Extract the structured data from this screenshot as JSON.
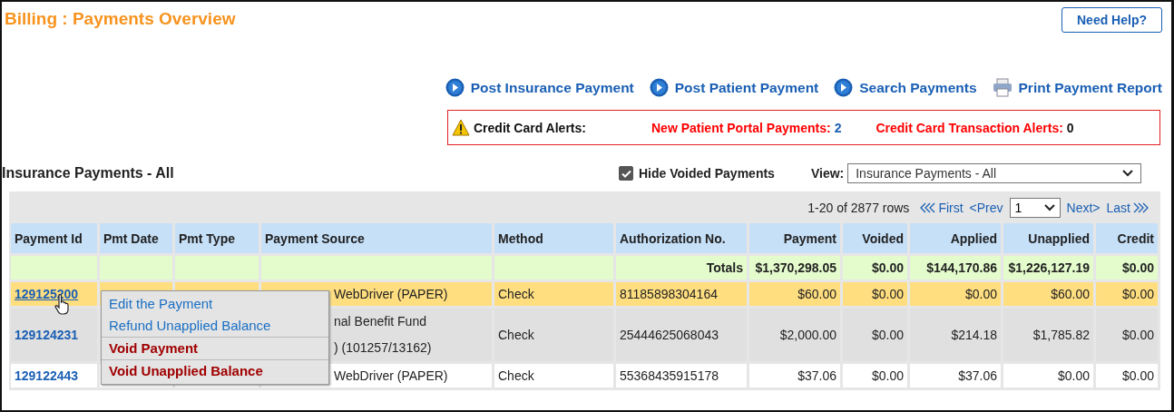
{
  "page_title": "Billing : Payments Overview",
  "help_button": "Need Help?",
  "actions": [
    {
      "kind": "play",
      "label": "Post Insurance Payment"
    },
    {
      "kind": "play",
      "label": "Post Patient Payment"
    },
    {
      "kind": "play",
      "label": "Search Payments"
    },
    {
      "kind": "print",
      "label": "Print Payment Report"
    }
  ],
  "alerts": {
    "title": "Credit Card Alerts:",
    "items": [
      {
        "label": "New Patient Portal Payments:",
        "count": "2",
        "linked": true
      },
      {
        "label": "Credit Card Transaction Alerts:",
        "count": "0",
        "linked": false
      }
    ]
  },
  "section_title": "Insurance Payments - All",
  "hide_voided": {
    "label": "Hide Voided Payments",
    "checked": true
  },
  "view": {
    "label": "View:",
    "value": "Insurance Payments - All"
  },
  "pager": {
    "summary": "1-20 of 2877 rows",
    "first": "First",
    "prev": "<Prev",
    "page": "1",
    "next": "Next>",
    "last": "Last"
  },
  "columns": [
    "Payment Id",
    "Pmt Date",
    "Pmt Type",
    "Payment Source",
    "Method",
    "Authorization No.",
    "Payment",
    "Voided",
    "Applied",
    "Unapplied",
    "Credit"
  ],
  "totals": {
    "label": "Totals",
    "payment": "$1,370,298.05",
    "voided": "$0.00",
    "applied": "$144,170.86",
    "unapplied": "$1,226,127.19",
    "credit": "$0.00"
  },
  "rows": [
    {
      "selected": true,
      "payment_id": "129125200",
      "source": [
        "WebDriver (PAPER)"
      ],
      "method": "Check",
      "auth": "81185898304164",
      "payment": "$60.00",
      "voided": "$0.00",
      "applied": "$0.00",
      "unapplied": "$60.00",
      "credit": "$0.00"
    },
    {
      "selected": false,
      "payment_id": "129124231",
      "source": [
        "nal Benefit Fund",
        ") (101257/13162)"
      ],
      "method": "Check",
      "auth": "25444625068043",
      "payment": "$2,000.00",
      "voided": "$0.00",
      "applied": "$214.18",
      "unapplied": "$1,785.82",
      "credit": "$0.00"
    },
    {
      "selected": false,
      "payment_id": "129122443",
      "source": [
        "WebDriver (PAPER)"
      ],
      "method": "Check",
      "auth": "55368435915178",
      "payment": "$37.06",
      "voided": "$0.00",
      "applied": "$37.06",
      "unapplied": "$0.00",
      "credit": "$0.00"
    }
  ],
  "context_menu": [
    {
      "kind": "link",
      "label": "Edit the Payment"
    },
    {
      "kind": "link",
      "label": "Refund Unapplied Balance"
    },
    {
      "kind": "danger",
      "label": "Void Payment"
    },
    {
      "kind": "danger",
      "label": "Void Unapplied Balance"
    }
  ]
}
